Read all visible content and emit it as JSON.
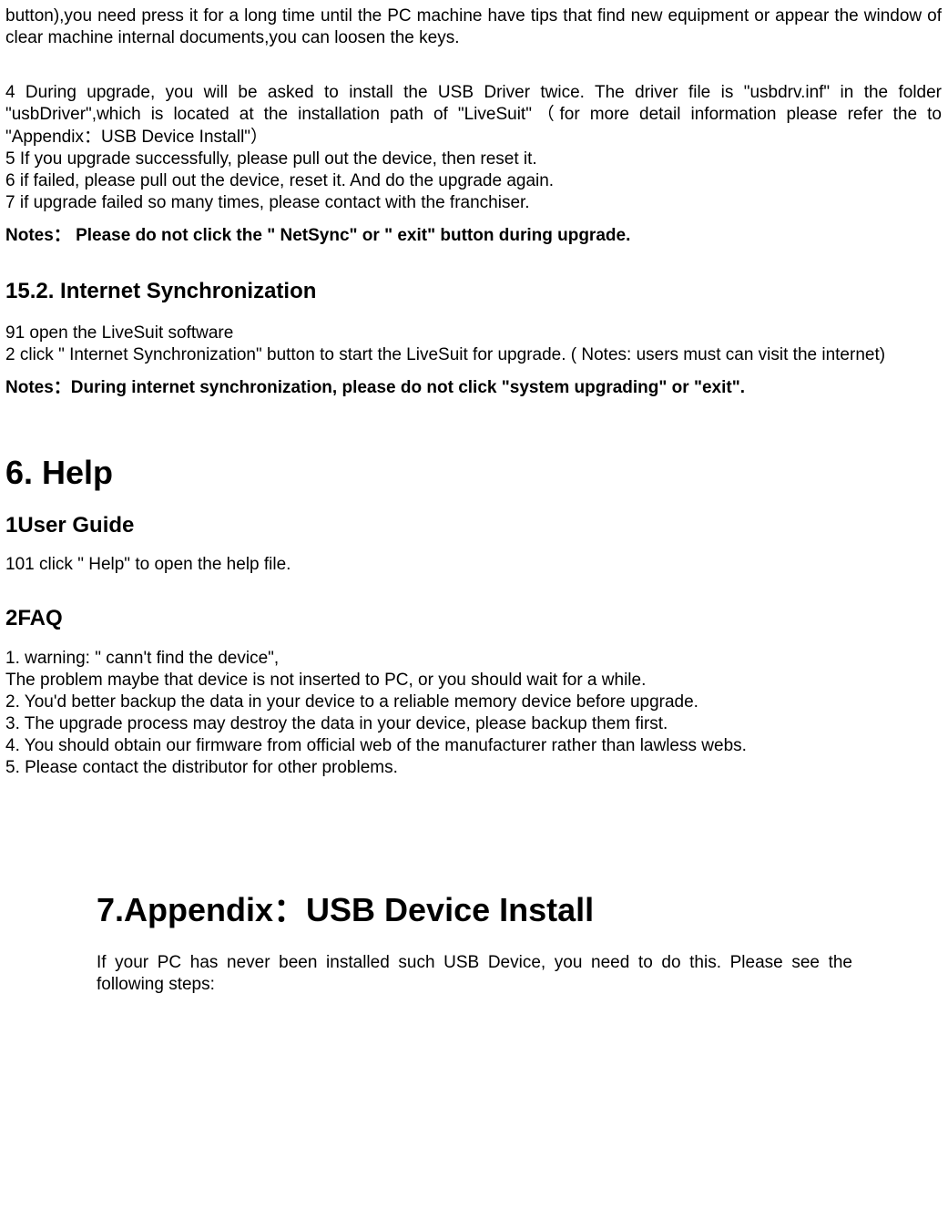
{
  "intro": {
    "line1": "button),you need press it for a long time until the PC machine have tips that find new equipment or appear the window of clear machine internal documents,you can loosen the keys."
  },
  "step4": "4 During upgrade, you will be asked to install the USB Driver twice. The driver file is \"usbdrv.inf\" in the folder \"usbDriver\",which is located at the installation path of \"LiveSuit\"（for more detail information please refer the to \"Appendix：USB Device Install\"）",
  "step5": "5 If you upgrade successfully, please pull out the device, then reset it.",
  "step6": "6 if failed, please pull out the device, reset it. And do the upgrade again.",
  "step7": "7 if upgrade failed so many times, please contact with the franchiser.",
  "notes1": "Notes：  Please do not click the \" NetSync\" or \" exit\" button during upgrade.",
  "sec152": {
    "heading": "15.2. Internet Synchronization",
    "item1": "91 open the LiveSuit software",
    "item2": "2 click \" Internet Synchronization\" button to start the LiveSuit for upgrade. ( Notes: users must can visit the internet)",
    "notes": "Notes：During internet synchronization, please do not click \"system upgrading\" or \"exit\"."
  },
  "sec6": {
    "heading": "6. Help",
    "userGuide": {
      "heading": "1User Guide",
      "item1": "101 click \" Help\" to open the help file."
    },
    "faq": {
      "heading": "2FAQ",
      "item1a": "1. warning: \" cann't find the device\",",
      "item1b": "The problem maybe that device is not inserted to PC, or you should wait for a while.",
      "item2": "2. You'd better backup the data in your device to a reliable memory device before upgrade.",
      "item3": "3. The upgrade process may destroy the data in your device, please backup them first.",
      "item4": "4. You should obtain our firmware from official web of the manufacturer rather than lawless webs.",
      "item5": "5. Please contact the distributor for other problems."
    }
  },
  "sec7": {
    "heading": "7.Appendix：USB Device Install",
    "intro": "If your PC has never been installed such USB Device, you need to do this. Please see the following steps:"
  }
}
